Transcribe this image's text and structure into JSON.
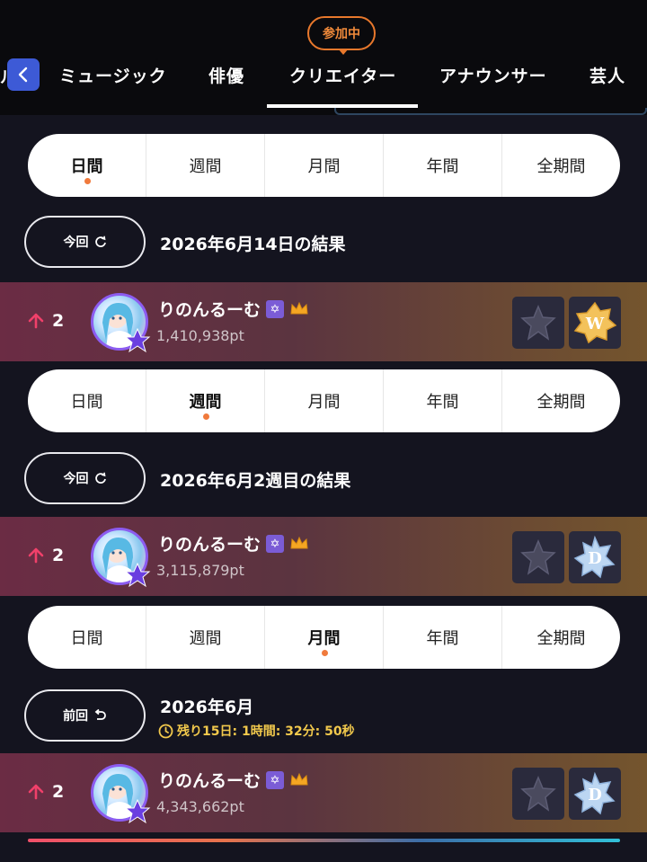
{
  "nav": {
    "join_badge": "参加中",
    "partial_tab": "ル",
    "tabs": [
      "ミュージック",
      "俳優",
      "クリエイター",
      "アナウンサー",
      "芸人"
    ],
    "active_tab": "クリエイター"
  },
  "periods": [
    "日間",
    "週間",
    "月間",
    "年間",
    "全期間"
  ],
  "sections": [
    {
      "active_period": "日間",
      "result_button": "今回",
      "result_text": "2026年6月14日の結果",
      "countdown": "",
      "entry": {
        "rank_change": "2",
        "name": "りのんるーむ",
        "points": "1,410,938pt",
        "medal2_letter": "W"
      }
    },
    {
      "active_period": "週間",
      "result_button": "今回",
      "result_text": "2026年6月2週目の結果",
      "countdown": "",
      "entry": {
        "rank_change": "2",
        "name": "りのんるーむ",
        "points": "3,115,879pt",
        "medal2_letter": "D"
      }
    },
    {
      "active_period": "月間",
      "result_button": "前回",
      "result_text": "2026年6月",
      "countdown": "残り15日: 1時間: 32分: 50秒",
      "entry": {
        "rank_change": "2",
        "name": "りのんるーむ",
        "points": "4,343,662pt",
        "medal2_letter": "D"
      }
    }
  ],
  "colors": {
    "accent_orange": "#f07a3c",
    "rank_up_pink": "#f0406a",
    "countdown_yellow": "#f2c94c",
    "back_button_blue": "#3d5ad6"
  },
  "icons": {
    "back": "chevron-left-icon",
    "refresh": "refresh-icon",
    "undo": "undo-arrow-icon",
    "rank_up": "arrow-up-icon",
    "clock": "clock-icon",
    "star_mark": "star-of-david-icon",
    "crown": "crown-icon"
  }
}
